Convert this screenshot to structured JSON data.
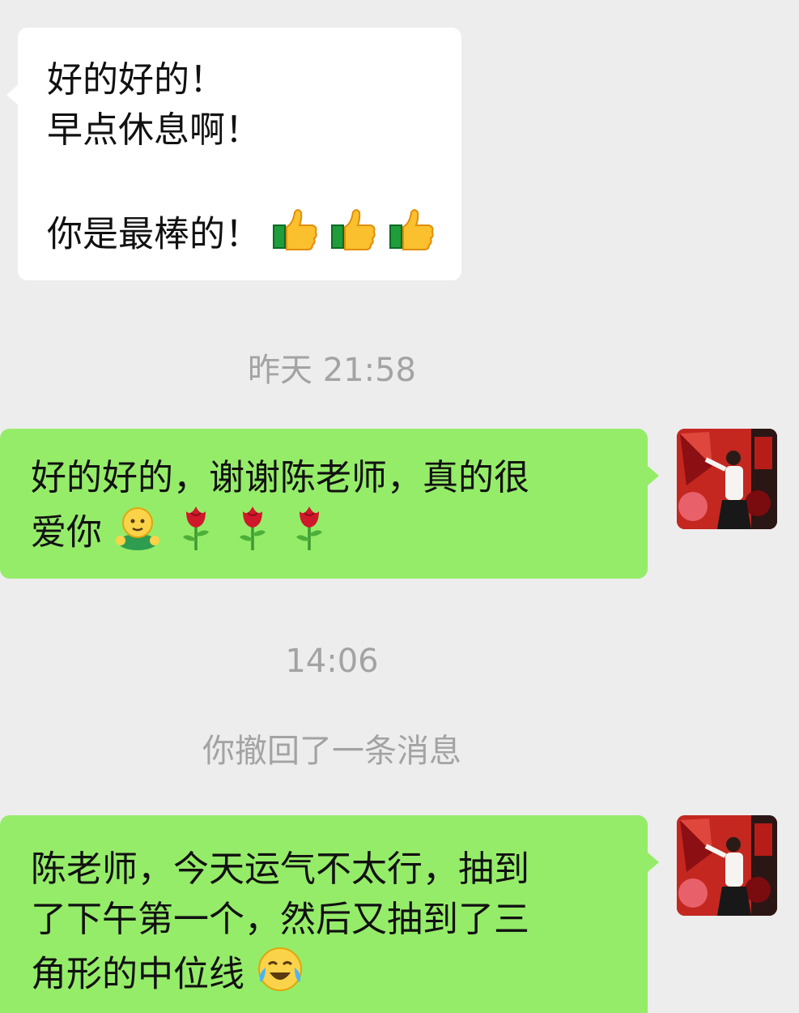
{
  "messages": [
    {
      "lines": [
        "好的好的！",
        "早点休息啊！",
        "",
        "你是最棒的！"
      ]
    },
    {
      "lines": [
        "好的好的，谢谢陈老师，真的很",
        "爱你"
      ]
    },
    {
      "lines": [
        "陈老师，今天运气不太行，抽到",
        "了下午第一个，然后又抽到了三",
        "角形的中位线"
      ]
    }
  ],
  "timestamps": [
    "昨天 21:58",
    "14:06"
  ],
  "system_notice": "你撤回了一条消息",
  "emojis": [
    "thumbs-up",
    "thumbs-up",
    "thumbs-up",
    "hugging-face",
    "rose",
    "rose",
    "rose",
    "face-with-tears-of-joy"
  ],
  "colors": {
    "background": "#ededed",
    "incoming_bubble": "#ffffff",
    "outgoing_bubble": "#95ec69",
    "meta_text": "#a3a3a3"
  }
}
